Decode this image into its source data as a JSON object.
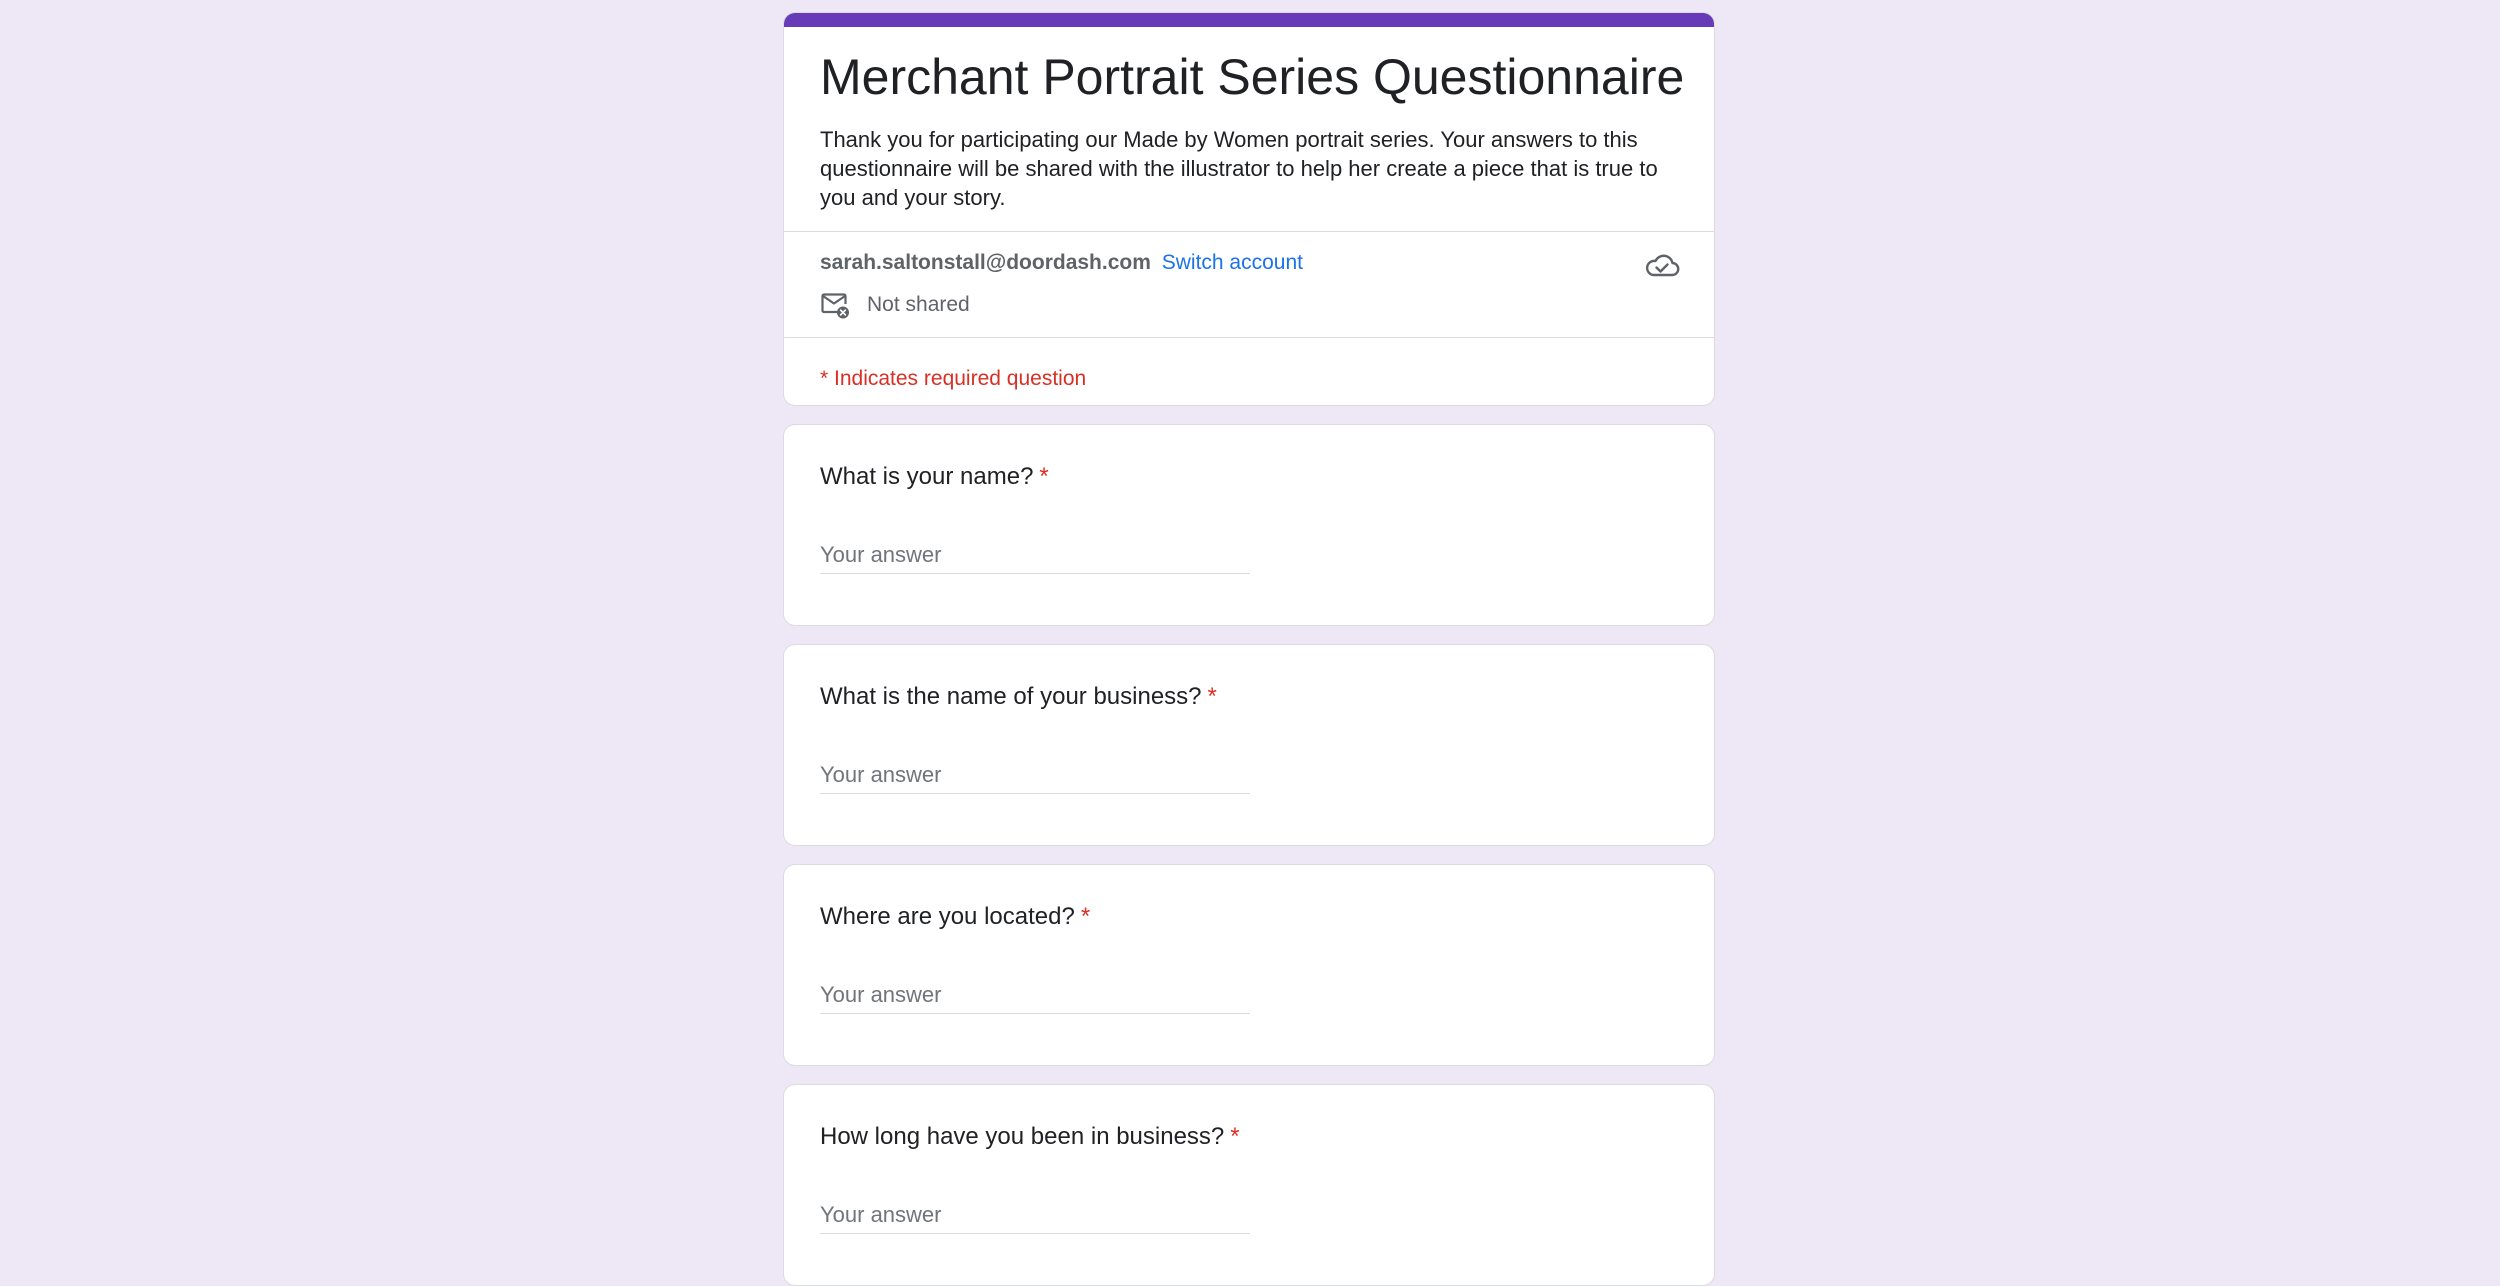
{
  "form": {
    "title": "Merchant Portrait Series Questionnaire",
    "description": "Thank you for participating our Made by Women portrait series. Your answers to this questionnaire will be shared with the illustrator to help her create a piece that is true to you and your story.",
    "account_email": "sarah.saltonstall@doordash.com",
    "switch_account_label": "Switch account",
    "not_shared_label": "Not shared",
    "required_note": "* Indicates required question",
    "accent_color": "#673ab7",
    "required_color": "#d93025",
    "link_color": "#1a73e8",
    "background_color": "#ede7f6",
    "icons": {
      "cloud": "cloud-check-icon",
      "mail": "mail-not-shared-icon"
    }
  },
  "questions": [
    {
      "label": "What is your name?",
      "required_mark": "*",
      "placeholder": "Your answer"
    },
    {
      "label": "What is the name of your business?",
      "required_mark": "*",
      "placeholder": "Your answer"
    },
    {
      "label": "Where are you located?",
      "required_mark": "*",
      "placeholder": "Your answer"
    },
    {
      "label": "How long have you been in business?",
      "required_mark": "*",
      "placeholder": "Your answer"
    }
  ]
}
